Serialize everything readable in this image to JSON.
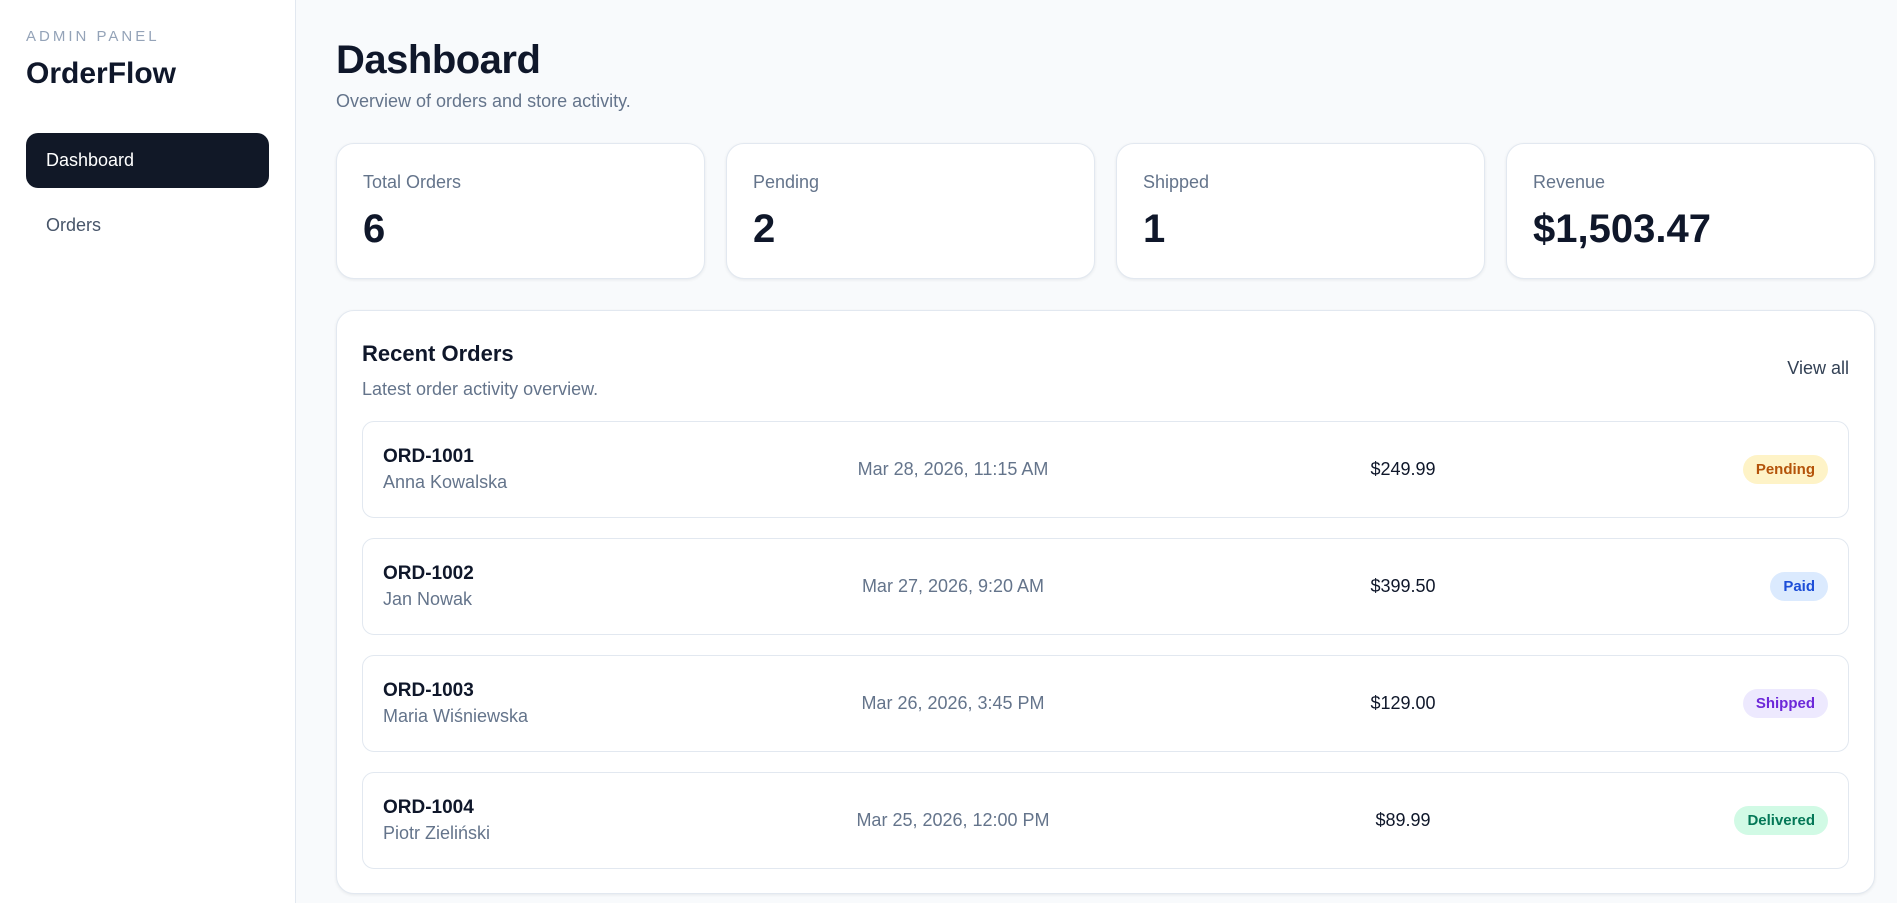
{
  "sidebar": {
    "kicker": "ADMIN PANEL",
    "brand": "OrderFlow",
    "items": [
      {
        "label": "Dashboard",
        "active": true
      },
      {
        "label": "Orders",
        "active": false
      }
    ]
  },
  "header": {
    "title": "Dashboard",
    "subtitle": "Overview of orders and store activity."
  },
  "stats": [
    {
      "label": "Total Orders",
      "value": "6"
    },
    {
      "label": "Pending",
      "value": "2"
    },
    {
      "label": "Shipped",
      "value": "1"
    },
    {
      "label": "Revenue",
      "value": "$1,503.47"
    }
  ],
  "recent_orders": {
    "title": "Recent Orders",
    "subtitle": "Latest order activity overview.",
    "view_all_label": "View all",
    "rows": [
      {
        "id": "ORD-1001",
        "customer": "Anna Kowalska",
        "date": "Mar 28, 2026, 11:15 AM",
        "total": "$249.99",
        "status": "Pending"
      },
      {
        "id": "ORD-1002",
        "customer": "Jan Nowak",
        "date": "Mar 27, 2026, 9:20 AM",
        "total": "$399.50",
        "status": "Paid"
      },
      {
        "id": "ORD-1003",
        "customer": "Maria Wiśniewska",
        "date": "Mar 26, 2026, 3:45 PM",
        "total": "$129.00",
        "status": "Shipped"
      },
      {
        "id": "ORD-1004",
        "customer": "Piotr Zieliński",
        "date": "Mar 25, 2026, 12:00 PM",
        "total": "$89.99",
        "status": "Delivered"
      }
    ]
  },
  "colors": {
    "nav_active_bg": "#111827",
    "pending": "#b45309",
    "paid": "#1d4ed8",
    "shipped": "#6d28d9",
    "delivered": "#047857"
  }
}
